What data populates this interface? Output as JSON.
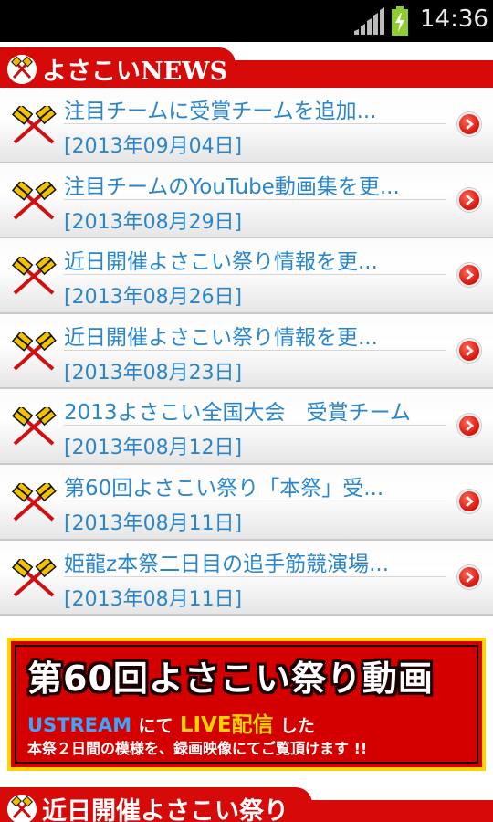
{
  "status_bar": {
    "time": "14:36",
    "signal_icon": "signal-icon",
    "battery_icon": "battery-charging-icon"
  },
  "news_section": {
    "title": "よさこいNEWS",
    "icon": "crossed-naruko-icon",
    "items": [
      {
        "title": "注目チームに受賞チームを追加...",
        "date": "[2013年09月04日]"
      },
      {
        "title": "注目チームのYouTube動画集を更...",
        "date": "[2013年08月29日]"
      },
      {
        "title": "近日開催よさこい祭り情報を更...",
        "date": "[2013年08月26日]"
      },
      {
        "title": "近日開催よさこい祭り情報を更...",
        "date": "[2013年08月23日]"
      },
      {
        "title": "2013よさこい全国大会　受賞チーム",
        "date": "[2013年08月12日]"
      },
      {
        "title": "第60回よさこい祭り「本祭」受...",
        "date": "[2013年08月11日]"
      },
      {
        "title": "姫龍z本祭二日目の追手筋競演場...",
        "date": "[2013年08月11日]"
      }
    ]
  },
  "banner": {
    "title": "第60回よさこい祭り動画",
    "ustream": "USTREAM",
    "nite": "にて",
    "live": "LIVE配信",
    "shita": "した",
    "subtitle": "本祭２日間の模様を、録画映像にてご覧頂けます !!",
    "colors": {
      "background": "#d40000",
      "border": "#ffd200"
    }
  },
  "upcoming_section": {
    "title": "近日開催よさこい祭り"
  },
  "colors": {
    "accent_red": "#d70a0a",
    "link_blue": "#2a86c9"
  }
}
